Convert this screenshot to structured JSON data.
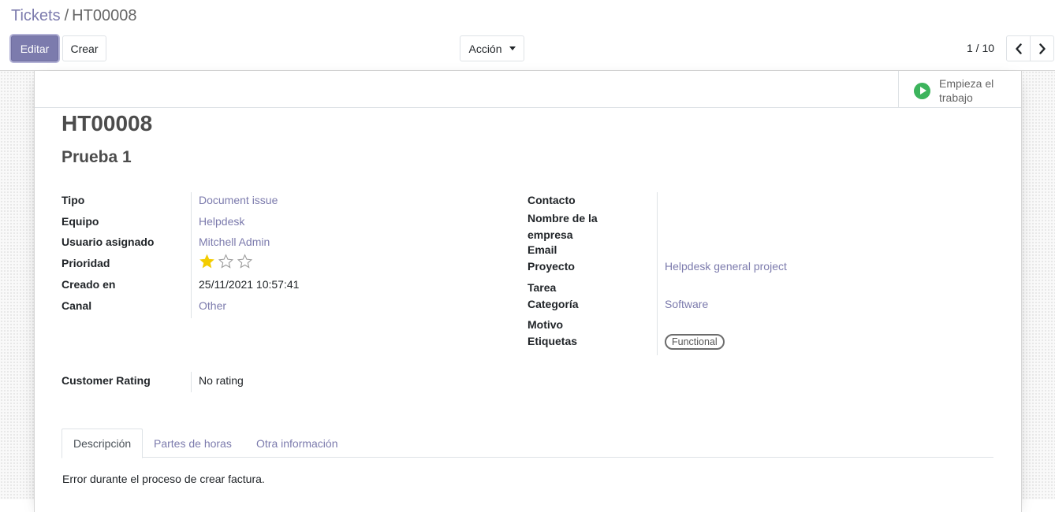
{
  "breadcrumb": {
    "parent": "Tickets",
    "separator": "/",
    "current": "HT00008"
  },
  "toolbar": {
    "edit_label": "Editar",
    "create_label": "Crear",
    "action_label": "Acción"
  },
  "pager": {
    "value": "1 / 10"
  },
  "stat_button": {
    "line1": "Empieza el",
    "line2": "trabajo",
    "icon": "play-circle-icon",
    "color": "#3cb45c"
  },
  "ticket": {
    "reference": "HT00008",
    "name": "Prueba 1"
  },
  "left_fields": {
    "tipo": {
      "label": "Tipo",
      "value": "Document issue"
    },
    "equipo": {
      "label": "Equipo",
      "value": "Helpdesk"
    },
    "usuario": {
      "label": "Usuario asignado",
      "value": "Mitchell Admin"
    },
    "prioridad": {
      "label": "Prioridad",
      "stars_filled": 1,
      "stars_total": 3
    },
    "creado": {
      "label": "Creado en",
      "value": "25/11/2021 10:57:41"
    },
    "canal": {
      "label": "Canal",
      "value": "Other"
    }
  },
  "right_fields": {
    "contacto": {
      "label": "Contacto",
      "value": ""
    },
    "empresa": {
      "label_line1": "Nombre de la",
      "label_line2": "empresa",
      "value": ""
    },
    "email": {
      "label": "Email",
      "value": ""
    },
    "proyecto": {
      "label": "Proyecto",
      "value": "Helpdesk general project"
    },
    "tarea": {
      "label": "Tarea",
      "value": ""
    },
    "categoria": {
      "label": "Categoría",
      "value": "Software"
    },
    "motivo": {
      "label": "Motivo",
      "value": ""
    },
    "etiquetas": {
      "label": "Etiquetas",
      "tags": [
        "Functional"
      ]
    }
  },
  "rating": {
    "label": "Customer Rating",
    "value": "No rating"
  },
  "tabs": [
    {
      "label": "Descripción",
      "active": true
    },
    {
      "label": "Partes de horas",
      "active": false
    },
    {
      "label": "Otra información",
      "active": false
    }
  ],
  "description": "Error durante el proceso de crear factura.",
  "colors": {
    "primary": "#7c7bad",
    "star_filled": "#f3cc00",
    "link": "#7c7bad"
  }
}
